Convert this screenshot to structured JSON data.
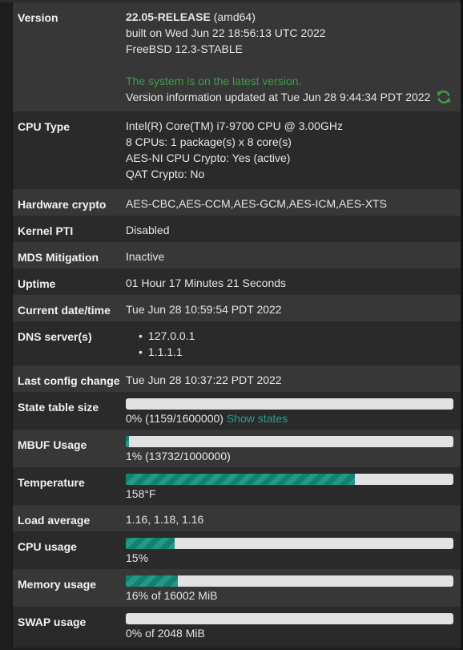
{
  "rows": {
    "version": {
      "label": "Version",
      "release": "22.05-RELEASE",
      "arch": "(amd64)",
      "built": "built on Wed Jun 22 18:56:13 UTC 2022",
      "os": "FreeBSD 12.3-STABLE",
      "status": "The system is on the latest version.",
      "updated": "Version information updated at Tue Jun 28 9:44:34 PDT 2022",
      "refresh_icon": "refresh-icon"
    },
    "cpu_type": {
      "label": "CPU Type",
      "lines": [
        "Intel(R) Core(TM) i7-9700 CPU @ 3.00GHz",
        "8 CPUs: 1 package(s) x 8 core(s)",
        "AES-NI CPU Crypto: Yes (active)",
        "QAT Crypto: No"
      ]
    },
    "hw_crypto": {
      "label": "Hardware crypto",
      "value": "AES-CBC,AES-CCM,AES-GCM,AES-ICM,AES-XTS"
    },
    "kernel_pti": {
      "label": "Kernel PTI",
      "value": "Disabled"
    },
    "mds": {
      "label": "MDS Mitigation",
      "value": "Inactive"
    },
    "uptime": {
      "label": "Uptime",
      "value": "01 Hour 17 Minutes 21 Seconds"
    },
    "datetime": {
      "label": "Current date/time",
      "value": "Tue Jun 28 10:59:54 PDT 2022"
    },
    "dns": {
      "label": "DNS server(s)",
      "servers": [
        "127.0.0.1",
        "1.1.1.1"
      ]
    },
    "last_config": {
      "label": "Last config change",
      "value": "Tue Jun 28 10:37:22 PDT 2022"
    },
    "state_table": {
      "label": "State table size",
      "percent": 0,
      "text": "0% (1159/1600000)",
      "link": "Show states"
    },
    "mbuf": {
      "label": "MBUF Usage",
      "percent": 1,
      "text": "1% (13732/1000000)"
    },
    "temperature": {
      "label": "Temperature",
      "percent": 70,
      "text": "158°F"
    },
    "load": {
      "label": "Load average",
      "value": "1.16, 1.18, 1.16"
    },
    "cpu_usage": {
      "label": "CPU usage",
      "percent": 15,
      "text": "15%"
    },
    "memory": {
      "label": "Memory usage",
      "percent": 16,
      "text": "16% of 16002 MiB"
    },
    "swap": {
      "label": "SWAP usage",
      "percent": 0,
      "text": "0% of 2048 MiB"
    }
  },
  "colors": {
    "accent": "#21a391",
    "status_green": "#3c9d46",
    "bar_fill": "#1f9a89",
    "bar_track": "#e2e2e2"
  }
}
